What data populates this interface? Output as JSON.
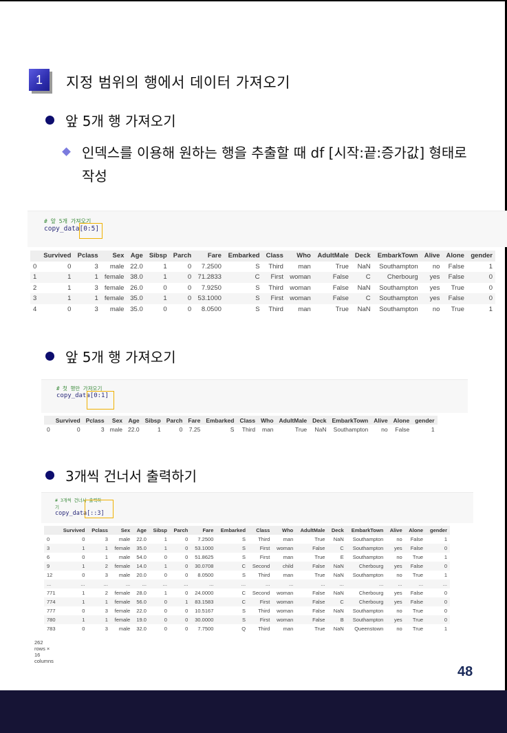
{
  "section": {
    "number": "1",
    "title": "지정 범위의 행에서 데이터 가져오기"
  },
  "bullets": [
    {
      "text": "앞 5개 행 가져오기"
    },
    {
      "text": "앞 5개 행 가져오기"
    },
    {
      "text": "3개씩 건너서 출력하기"
    }
  ],
  "sub_bullet": {
    "line1": "인덱스를 이용해 원하는 행을 추출할 때 df [시작:끝:증가값] 형태로",
    "line2": "작성"
  },
  "columns": [
    "Survived",
    "Pclass",
    "Sex",
    "Age",
    "Sibsp",
    "Parch",
    "Fare",
    "Embarked",
    "Class",
    "Who",
    "AdultMale",
    "Deck",
    "EmbarkTown",
    "Alive",
    "Alone",
    "gender"
  ],
  "cells": [
    {
      "comment": "# 앞 5개 가져오기",
      "code_prefix": "copy_data",
      "code_slice": "[0:5]",
      "rows": [
        [
          "0",
          "0",
          "3",
          "male",
          "22.0",
          "1",
          "0",
          "7.2500",
          "S",
          "Third",
          "man",
          "True",
          "NaN",
          "Southampton",
          "no",
          "False",
          "1"
        ],
        [
          "1",
          "1",
          "1",
          "female",
          "38.0",
          "1",
          "0",
          "71.2833",
          "C",
          "First",
          "woman",
          "False",
          "C",
          "Cherbourg",
          "yes",
          "False",
          "0"
        ],
        [
          "2",
          "1",
          "3",
          "female",
          "26.0",
          "0",
          "0",
          "7.9250",
          "S",
          "Third",
          "woman",
          "False",
          "NaN",
          "Southampton",
          "yes",
          "True",
          "0"
        ],
        [
          "3",
          "1",
          "1",
          "female",
          "35.0",
          "1",
          "0",
          "53.1000",
          "S",
          "First",
          "woman",
          "False",
          "C",
          "Southampton",
          "yes",
          "False",
          "0"
        ],
        [
          "4",
          "0",
          "3",
          "male",
          "35.0",
          "0",
          "0",
          "8.0500",
          "S",
          "Third",
          "man",
          "True",
          "NaN",
          "Southampton",
          "no",
          "True",
          "1"
        ]
      ]
    },
    {
      "comment": "# 첫 행만 가져오기",
      "code_prefix": "copy_data",
      "code_slice": "[0:1]",
      "rows": [
        [
          "0",
          "0",
          "3",
          "male",
          "22.0",
          "1",
          "0",
          "7.25",
          "S",
          "Third",
          "man",
          "True",
          "NaN",
          "Southampton",
          "no",
          "False",
          "1"
        ]
      ]
    },
    {
      "comment": "# 3개씩 건너서 출력하기",
      "code_prefix": "copy_data",
      "code_slice": "[::3]",
      "rows": [
        [
          "0",
          "0",
          "3",
          "male",
          "22.0",
          "1",
          "0",
          "7.2500",
          "S",
          "Third",
          "man",
          "True",
          "NaN",
          "Southampton",
          "no",
          "False",
          "1"
        ],
        [
          "3",
          "1",
          "1",
          "female",
          "35.0",
          "1",
          "0",
          "53.1000",
          "S",
          "First",
          "woman",
          "False",
          "C",
          "Southampton",
          "yes",
          "False",
          "0"
        ],
        [
          "6",
          "0",
          "1",
          "male",
          "54.0",
          "0",
          "0",
          "51.8625",
          "S",
          "First",
          "man",
          "True",
          "E",
          "Southampton",
          "no",
          "True",
          "1"
        ],
        [
          "9",
          "1",
          "2",
          "female",
          "14.0",
          "1",
          "0",
          "30.0708",
          "C",
          "Second",
          "child",
          "False",
          "NaN",
          "Cherbourg",
          "yes",
          "False",
          "0"
        ],
        [
          "12",
          "0",
          "3",
          "male",
          "20.0",
          "0",
          "0",
          "8.0500",
          "S",
          "Third",
          "man",
          "True",
          "NaN",
          "Southampton",
          "no",
          "True",
          "1"
        ],
        [
          "...",
          "...",
          "...",
          "...",
          "...",
          "...",
          "...",
          "...",
          "...",
          "...",
          "...",
          "...",
          "...",
          "...",
          "...",
          "...",
          "..."
        ],
        [
          "771",
          "1",
          "2",
          "female",
          "28.0",
          "1",
          "0",
          "24.0000",
          "C",
          "Second",
          "woman",
          "False",
          "NaN",
          "Cherbourg",
          "yes",
          "False",
          "0"
        ],
        [
          "774",
          "1",
          "1",
          "female",
          "56.0",
          "0",
          "1",
          "83.1583",
          "C",
          "First",
          "woman",
          "False",
          "C",
          "Cherbourg",
          "yes",
          "False",
          "0"
        ],
        [
          "777",
          "0",
          "3",
          "female",
          "22.0",
          "0",
          "0",
          "10.5167",
          "S",
          "Third",
          "woman",
          "False",
          "NaN",
          "Southampton",
          "no",
          "True",
          "0"
        ],
        [
          "780",
          "1",
          "1",
          "female",
          "19.0",
          "0",
          "0",
          "30.0000",
          "S",
          "First",
          "woman",
          "False",
          "B",
          "Southampton",
          "yes",
          "True",
          "0"
        ],
        [
          "783",
          "0",
          "3",
          "male",
          "32.0",
          "0",
          "0",
          "7.7500",
          "Q",
          "Third",
          "man",
          "True",
          "NaN",
          "Queenstown",
          "no",
          "True",
          "1"
        ]
      ],
      "shape_note": "262 rows × 16 columns"
    }
  ],
  "page_number": "48",
  "colors": {
    "bullet_dot": "#0d0d6e",
    "diamond": "#7b7bde",
    "highlight_box": "#f0b000",
    "footer_band": "#161435",
    "page_number": "#1a2a5a"
  }
}
